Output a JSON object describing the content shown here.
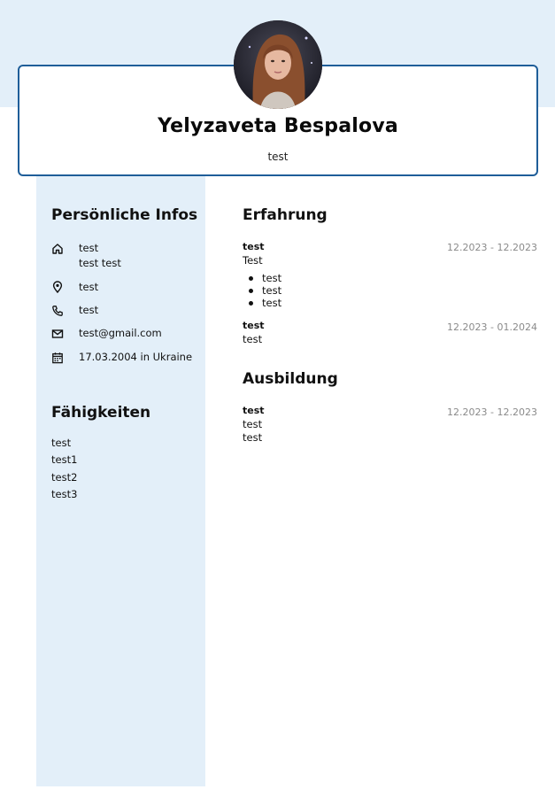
{
  "header": {
    "name": "Yelyzaveta Bespalova",
    "subtitle": "test"
  },
  "sidebar": {
    "personal_title": "Persönliche Infos",
    "address_line1": "test",
    "address_line2": "test test",
    "location": "test",
    "phone": "test",
    "email": "test@gmail.com",
    "birth": "17.03.2004 in Ukraine",
    "skills_title": "Fähigkeiten",
    "skills": [
      "test",
      "test1",
      "test2",
      "test3"
    ]
  },
  "experience": {
    "title": "Erfahrung",
    "entries": [
      {
        "title": "test",
        "date": "12.2023 - 12.2023",
        "description": "Test",
        "bullets": [
          "test",
          "test",
          "test"
        ]
      },
      {
        "title": "test",
        "date": "12.2023 - 01.2024",
        "description": "test"
      }
    ]
  },
  "education": {
    "title": "Ausbildung",
    "entries": [
      {
        "title": "test",
        "date": "12.2023 - 12.2023",
        "line1": "test",
        "line2": "test"
      }
    ]
  },
  "icons": {
    "address": "home-icon",
    "location": "map-pin-icon",
    "phone": "phone-icon",
    "email": "mail-icon",
    "birth": "calendar-icon"
  },
  "colors": {
    "accent": "#1f5e99",
    "panel": "#e3eff9",
    "date": "#8a8a8a"
  }
}
